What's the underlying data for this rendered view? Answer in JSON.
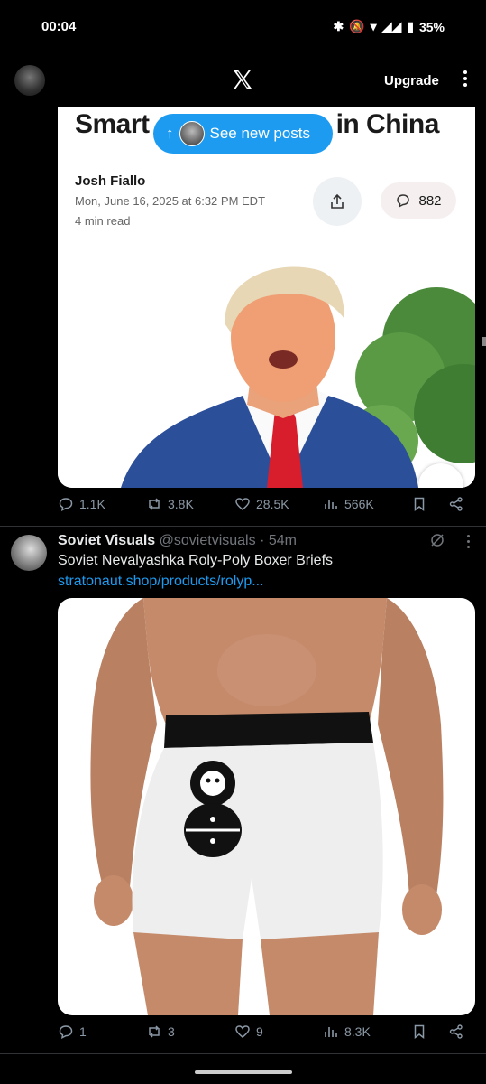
{
  "status": {
    "time": "00:04",
    "battery": "35%"
  },
  "nav": {
    "upgrade_label": "Upgrade"
  },
  "new_posts": {
    "label": "See new posts",
    "arrow": "↑"
  },
  "article": {
    "title": "Smartphone made in China",
    "title_visible_left": "Smart",
    "title_visible_right": "e in China",
    "author": "Josh Fiallo",
    "date": "Mon, June 16, 2025 at 6:32 PM EDT",
    "read_time": "4 min read",
    "comment_count": "882"
  },
  "tweet1_actions": {
    "replies": "1.1K",
    "reposts": "3.8K",
    "likes": "28.5K",
    "views": "566K"
  },
  "tweet2": {
    "name": "Soviet Visuals",
    "handle": "@sovietvisuals",
    "time": "· 54m",
    "text": "Soviet Nevalyashka Roly-Poly Boxer Briefs",
    "link": "stratonaut.shop/products/rolyp...",
    "actions": {
      "replies": "1",
      "reposts": "3",
      "likes": "9",
      "views": "8.3K"
    }
  },
  "colors": {
    "accent": "#1d9bf0",
    "background": "#000000",
    "muted": "#8b98a5"
  }
}
